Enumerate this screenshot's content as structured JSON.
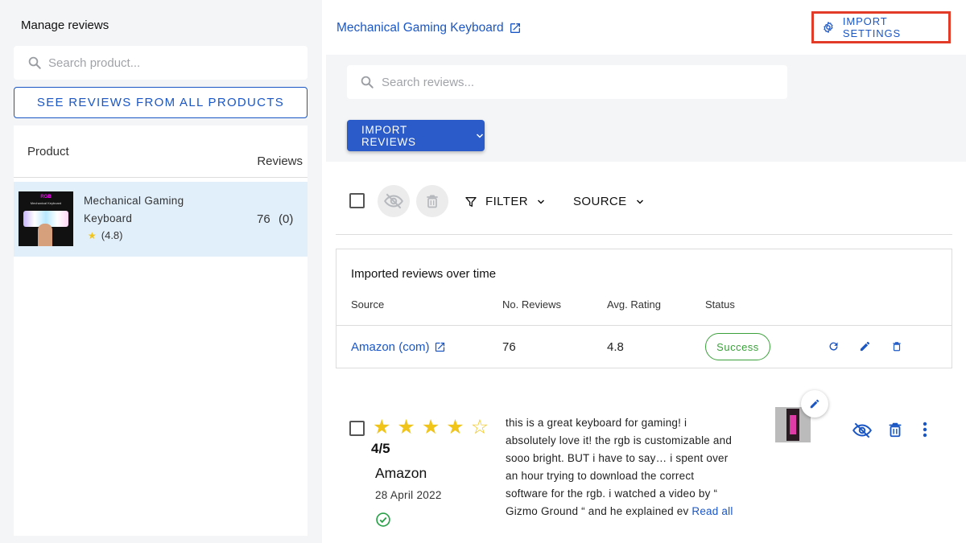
{
  "sidebar": {
    "title": "Manage reviews",
    "search_placeholder": "Search product...",
    "see_all_label": "SEE REVIEWS FROM ALL PRODUCTS",
    "table": {
      "col_product": "Product",
      "col_reviews": "Reviews",
      "rows": [
        {
          "name": "Mechanical Gaming Keyboard",
          "rating": "(4.8)",
          "reviews": "76",
          "pending": "(0)",
          "thumb_text": "RGB",
          "thumb_sub": "Mechanical Keyboard"
        }
      ]
    }
  },
  "header": {
    "product_link": "Mechanical Gaming Keyboard",
    "import_settings_label": "IMPORT SETTINGS"
  },
  "reviews_search": {
    "placeholder": "Search reviews..."
  },
  "import_button": {
    "label": "IMPORT REVIEWS"
  },
  "toolbar": {
    "filter_label": "FILTER",
    "source_label": "SOURCE"
  },
  "imports_card": {
    "title": "Imported reviews over time",
    "columns": [
      "Source",
      "No. Reviews",
      "Avg. Rating",
      "Status"
    ],
    "rows": [
      {
        "source": "Amazon (com)",
        "count": "76",
        "avg": "4.8",
        "status": "Success"
      }
    ]
  },
  "review": {
    "rating": 4,
    "max_rating": 5,
    "score_text": "4/5",
    "source": "Amazon",
    "date": "28 April 2022",
    "text": " this is a great keyboard for gaming! i absolutely love it! the rgb is customizable and sooo bright. BUT i have to say… i spent over an hour trying to download the correct software for the rgb. i watched a video by “ Gizmo Ground “ and he explained ev ",
    "read_all": "Read all"
  },
  "colors": {
    "accent": "#1a56c4",
    "primary_button": "#2a5bc9",
    "highlight_border": "#e23b27",
    "success": "#3aa13a",
    "star": "#f0c419",
    "selected_row": "#e1effb"
  }
}
